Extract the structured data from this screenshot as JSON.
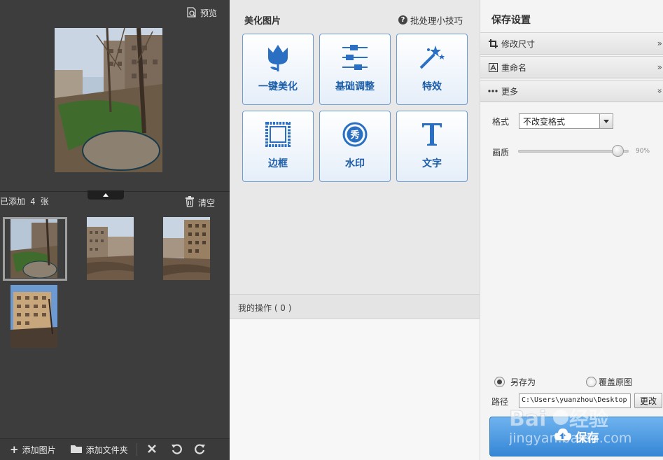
{
  "left_panel": {
    "preview_label": "预览",
    "added_count": "已添加 4 张",
    "clear_label": "清空",
    "thumbnails": [
      "thumb-1",
      "thumb-2",
      "thumb-3",
      "thumb-4"
    ],
    "bottom_bar": {
      "add_image": "添加图片",
      "add_folder": "添加文件夹"
    }
  },
  "middle_panel": {
    "title": "美化图片",
    "tips": "批处理小技巧",
    "tools": [
      {
        "label": "一键美化",
        "icon": "tulip-icon"
      },
      {
        "label": "基础调整",
        "icon": "sliders-icon"
      },
      {
        "label": "特效",
        "icon": "magic-wand-icon"
      },
      {
        "label": "边框",
        "icon": "frame-icon"
      },
      {
        "label": "水印",
        "icon": "watermark-icon"
      },
      {
        "label": "文字",
        "icon": "text-icon"
      }
    ],
    "ops_label": "我的操作 ( 0 )"
  },
  "right_panel": {
    "title": "保存设置",
    "sections": [
      {
        "label": "修改尺寸",
        "icon": "crop-icon"
      },
      {
        "label": "重命名",
        "icon": "rename-icon"
      },
      {
        "label": "更多",
        "icon": "more-icon"
      }
    ],
    "format_label": "格式",
    "format_value": "不改变格式",
    "quality_label": "画质",
    "quality_value": "90%",
    "quality_fraction": 0.9,
    "save_as_label": "另存为",
    "overwrite_label": "覆盖原图",
    "path_label": "路径",
    "path_value": "C:\\Users\\yuanzhou\\Desktop",
    "change_label": "更改",
    "save_label": "保存"
  },
  "watermark": {
    "brand": "Baidu经验",
    "url": "jingyan.baidu.com"
  },
  "colors": {
    "left_bg": "#3d3d3d",
    "tool_text": "#1d5ea8",
    "save_button": "#3586d6"
  }
}
